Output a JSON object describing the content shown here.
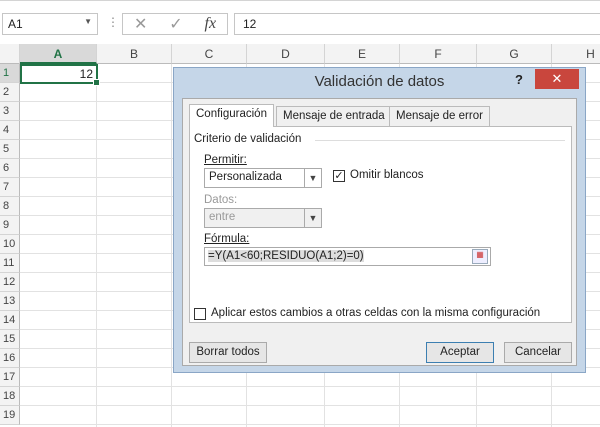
{
  "formula_bar": {
    "name_box": "A1",
    "value": "12",
    "cancel_icon": "x-icon",
    "enter_icon": "check-icon",
    "fx": "fx"
  },
  "columns": [
    "A",
    "B",
    "C",
    "D",
    "E",
    "F",
    "G",
    "H"
  ],
  "rows": [
    "1",
    "2",
    "3",
    "4",
    "5",
    "6",
    "7",
    "8",
    "9",
    "10",
    "11",
    "12",
    "13",
    "14",
    "15",
    "16",
    "17",
    "18",
    "19"
  ],
  "cells": {
    "A1": "12"
  },
  "dialog": {
    "title": "Validación de datos",
    "help": "?",
    "close": "✕",
    "tabs": [
      "Configuración",
      "Mensaje de entrada",
      "Mensaje de error"
    ],
    "group_label": "Criterio de validación",
    "permitir_label": "Permitir:",
    "permitir_value": "Personalizada",
    "omitir_label": "Omitir blancos",
    "omitir_checked": true,
    "datos_label": "Datos:",
    "datos_value": "entre",
    "formula_label": "Fórmula:",
    "formula_value": "=Y(A1<60;RESIDUO(A1;2)=0)",
    "apply_label": "Aplicar estos cambios a otras celdas con la misma configuración",
    "apply_checked": false,
    "buttons": {
      "clear": "Borrar todos",
      "ok": "Aceptar",
      "cancel": "Cancelar"
    }
  }
}
